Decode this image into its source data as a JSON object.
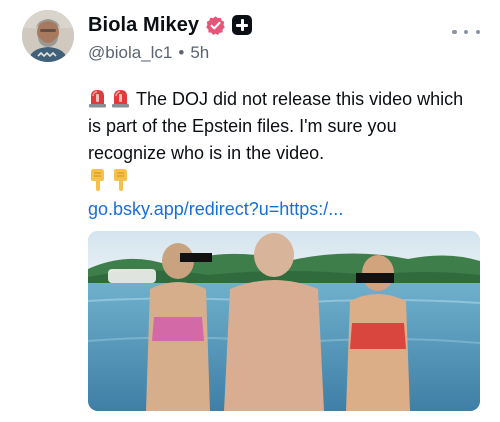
{
  "post": {
    "author": {
      "display_name": "Biola Mikey",
      "handle": "@biola_lc1",
      "separator": "•",
      "time": "5h"
    },
    "text": {
      "line1": "The DOJ did not release this video which",
      "line2": "is part of the Epstein files. I'm sure you",
      "line3": "recognize who is in the video."
    },
    "link": "go.bsky.app/redirect?u=https:/...",
    "icons": {
      "verified": "verified-badge-icon",
      "plus": "plus-badge-icon",
      "more": "more-options-icon",
      "emoji_siren": "siren-emoji-icon",
      "emoji_pointing": "pointing-down-emoji-icon"
    },
    "colors": {
      "verified_pink": "#e8557a",
      "link_blue": "#1a6fd6",
      "muted_text": "#5b6470"
    }
  }
}
